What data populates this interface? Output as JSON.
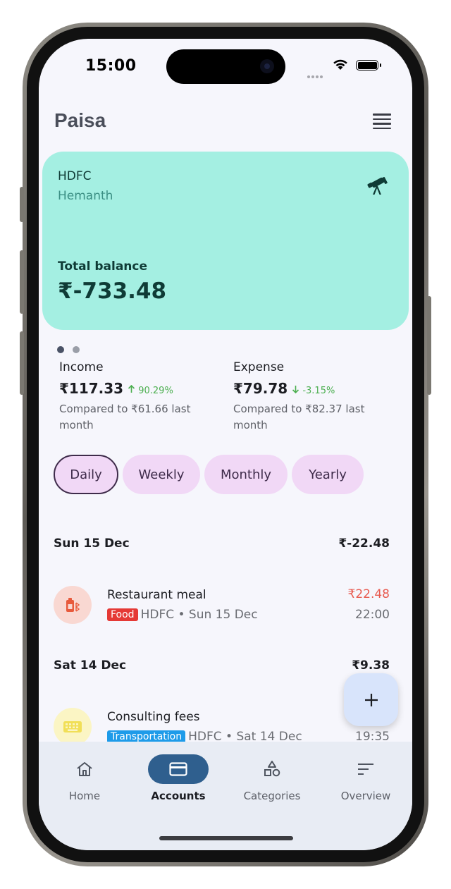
{
  "status_bar": {
    "time": "15:00"
  },
  "header": {
    "title": "Paisa"
  },
  "account_card": {
    "bank": "HDFC",
    "holder": "Hemanth",
    "balance_label": "Total balance",
    "balance": "₹-733.48"
  },
  "summary": {
    "income": {
      "label": "Income",
      "amount": "₹117.33",
      "change": "90.29%",
      "compare": "Compared to ₹61.66 last month"
    },
    "expense": {
      "label": "Expense",
      "amount": "₹79.78",
      "change": "-3.15%",
      "compare": "Compared to ₹82.37 last month"
    }
  },
  "filters": {
    "options": [
      "Daily",
      "Weekly",
      "Monthly",
      "Yearly"
    ],
    "selected": "Daily"
  },
  "transactions": {
    "days": [
      {
        "date": "Sun 15 Dec",
        "total": "₹-22.48"
      },
      {
        "date": "Sat 14 Dec",
        "total": "₹9.38"
      }
    ],
    "items": [
      {
        "title": "Restaurant meal",
        "tag": "Food",
        "meta": "HDFC • Sun 15 Dec",
        "amount": "₹22.48",
        "time": "22:00"
      },
      {
        "title": "Consulting fees",
        "tag": "Transportation",
        "meta": "HDFC • Sat 14 Dec",
        "amount": "",
        "time": "19:35"
      }
    ]
  },
  "fab": {
    "icon": "plus-icon"
  },
  "bottom_nav": {
    "items": [
      {
        "label": "Home",
        "icon": "home-icon"
      },
      {
        "label": "Accounts",
        "icon": "card-icon"
      },
      {
        "label": "Categories",
        "icon": "shapes-icon"
      },
      {
        "label": "Overview",
        "icon": "sort-icon"
      }
    ],
    "active": "Accounts"
  },
  "colors": {
    "card_bg": "#a4efe2",
    "chip_bg": "#f1d8f6",
    "expense_red": "#e85a4f",
    "income_green": "#4caf50",
    "food_tag": "#e53935",
    "transport_tag": "#1e9be9",
    "nav_active": "#2f5f8e"
  }
}
